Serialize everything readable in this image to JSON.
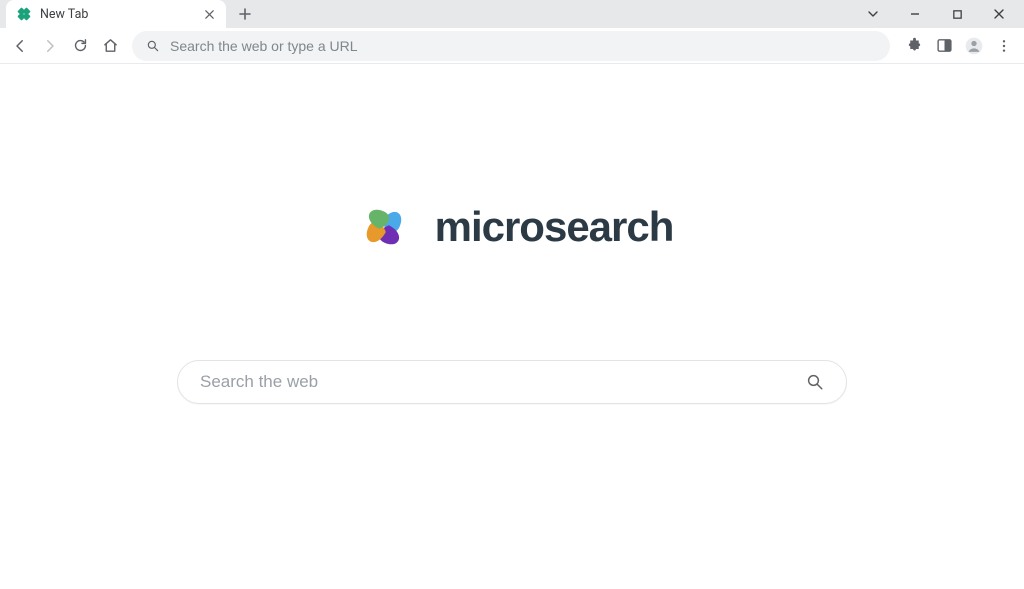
{
  "tab": {
    "title": "New Tab"
  },
  "omnibox": {
    "placeholder": "Search the web or type a URL",
    "value": ""
  },
  "brand": {
    "name": "microsearch",
    "logo_colors": {
      "top": "#4aa9e8",
      "right": "#6f2fb3",
      "bottom": "#e79a2b",
      "left": "#66b36a"
    }
  },
  "search": {
    "placeholder": "Search the web",
    "value": ""
  }
}
